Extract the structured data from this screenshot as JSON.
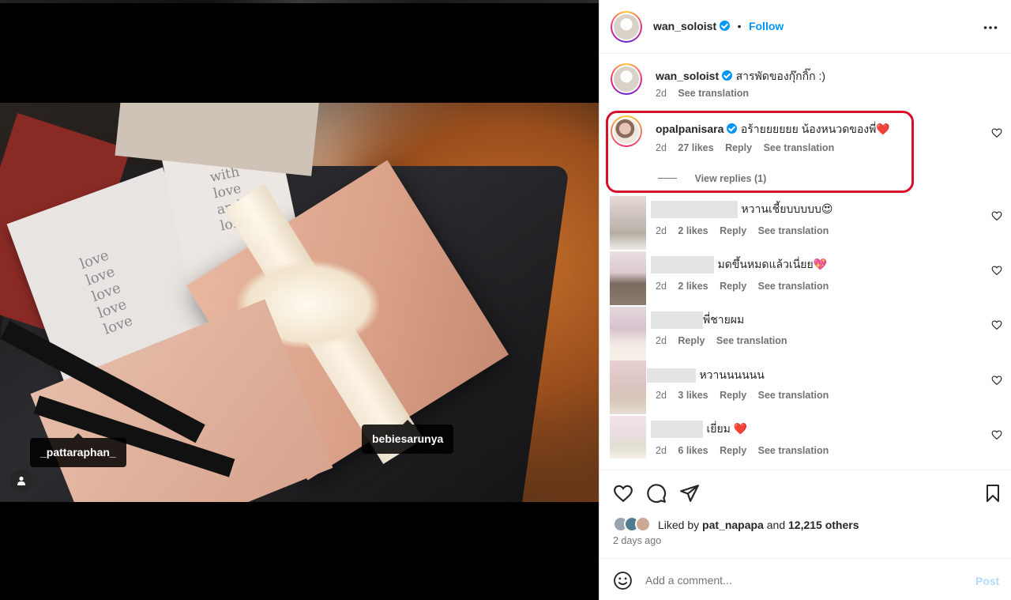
{
  "media": {
    "tags": [
      {
        "label": "_pattaraphan_"
      },
      {
        "label": "bebiesarunya"
      }
    ],
    "icons": {
      "user_tags": "person-icon"
    }
  },
  "post": {
    "author": "wan_soloist",
    "follow_label": "Follow",
    "separator": "•",
    "more_icon": "more-horizontal-icon",
    "caption": {
      "username": "wan_soloist",
      "text": "สารพัดของกุ๊กกิ๊ก :)",
      "time": "2d",
      "see_translation": "See translation"
    }
  },
  "comments": [
    {
      "username": "opalpanisara",
      "verified": true,
      "text": "อร้ายยยยยย น้องหนวดของพี่❤️",
      "time": "2d",
      "likes": "27 likes",
      "reply": "Reply",
      "see_translation": "See translation",
      "view_replies": "View replies (1)",
      "highlighted": true
    },
    {
      "username": "",
      "text": "หวานเชี้ยบบบบบ😍",
      "time": "2d",
      "likes": "2 likes",
      "reply": "Reply",
      "see_translation": "See translation"
    },
    {
      "username": "",
      "text": "มดขึ้นหมดแล้วเนี่ยย💖",
      "time": "2d",
      "likes": "2 likes",
      "reply": "Reply",
      "see_translation": "See translation"
    },
    {
      "username": "",
      "text": "พี่ชายผม",
      "time": "2d",
      "likes": "",
      "reply": "Reply",
      "see_translation": "See translation"
    },
    {
      "username": "",
      "text": "หวานนนนนน",
      "time": "2d",
      "likes": "3 likes",
      "reply": "Reply",
      "see_translation": "See translation"
    },
    {
      "username": "",
      "text": "เยี่ยม ❤️",
      "time": "2d",
      "likes": "6 likes",
      "reply": "Reply",
      "see_translation": "See translation"
    }
  ],
  "actions": {
    "liked_by_prefix": "Liked by",
    "liked_by_user": "pat_napapa",
    "and": "and",
    "others": "12,215 others",
    "date": "2 days ago"
  },
  "comment_box": {
    "placeholder": "Add a comment...",
    "post_label": "Post"
  },
  "colors": {
    "accent": "#0095f6",
    "highlight_border": "#d4102a",
    "text_secondary": "#737373"
  }
}
